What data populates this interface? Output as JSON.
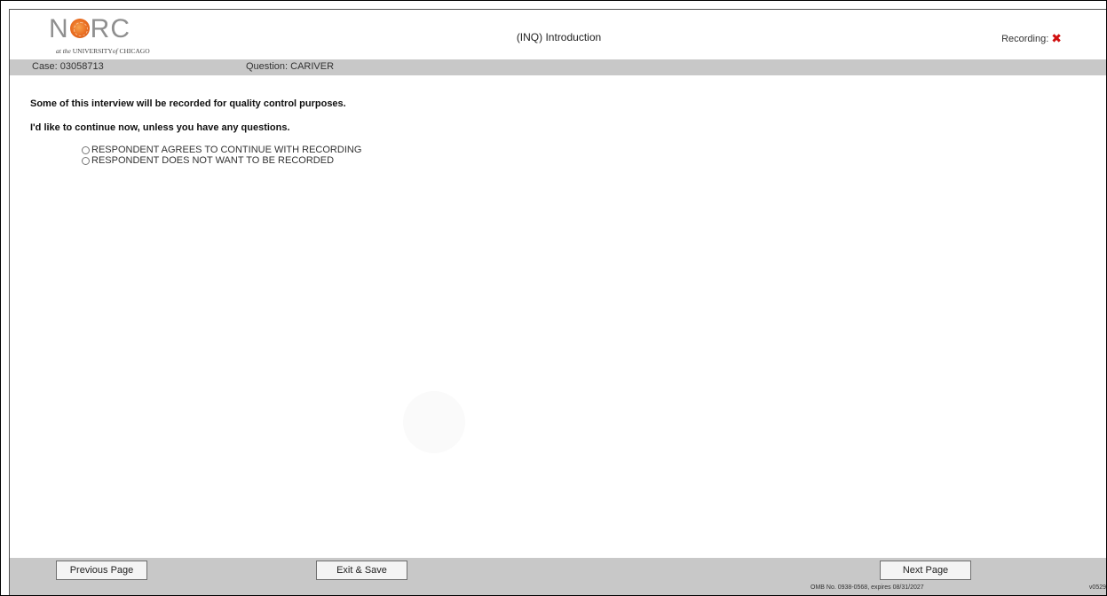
{
  "header": {
    "logo": {
      "word": "NORC",
      "subtitle_prefix": "at the",
      "subtitle_main": "UNIVERSITY",
      "subtitle_of": "of",
      "subtitle_end": "CHICAGO"
    },
    "title": "(INQ) Introduction",
    "recording_label": "Recording:",
    "recording_icon": "x-icon",
    "recording_icon_color": "#d01010"
  },
  "casebar": {
    "case": "Case: 03058713",
    "question": "Question: CARIVER"
  },
  "main": {
    "question_lines": [
      "Some of this interview will be recorded for quality control purposes.",
      "I'd like to continue now, unless you have any questions."
    ],
    "options": [
      {
        "label": "RESPONDENT AGREES TO CONTINUE WITH RECORDING",
        "selected": false
      },
      {
        "label": "RESPONDENT DOES NOT WANT TO BE RECORDED",
        "selected": false
      }
    ]
  },
  "footer": {
    "previous_label": "Previous Page",
    "exit_label": "Exit & Save",
    "next_label": "Next Page",
    "omb_text": "OMB No. 0938-0568, expires 08/31/2027",
    "version": "v0529"
  },
  "colors": {
    "bar_gray": "#c8c8c8",
    "logo_orange": "#e86a1e",
    "recording_red": "#d01010"
  }
}
